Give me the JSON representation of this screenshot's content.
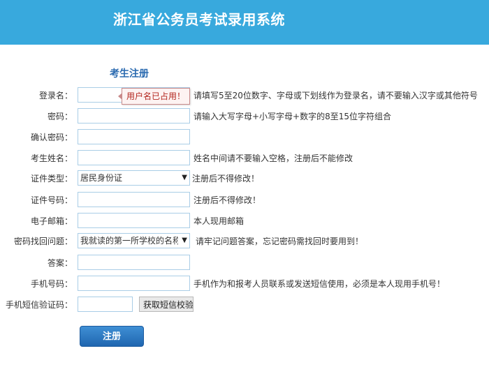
{
  "header": {
    "title": "浙江省公务员考试录用系统"
  },
  "form": {
    "section_title": "考生注册",
    "username": {
      "label": "登录名：",
      "value": "",
      "hint": "请填写5至20位数字、字母或下划线作为登录名，请不要输入汉字或其他符号",
      "error_tip": "用户名已占用！"
    },
    "password": {
      "label": "密码：",
      "value": "",
      "hint": "请输入大写字母+小写字母+数字的8至15位字符组合"
    },
    "confirm_password": {
      "label": "确认密码：",
      "value": ""
    },
    "real_name": {
      "label": "考生姓名：",
      "value": "",
      "hint": "姓名中间请不要输入空格，注册后不能修改"
    },
    "id_type": {
      "label": "证件类型：",
      "value": "居民身份证",
      "hint": "注册后不得修改！"
    },
    "id_number": {
      "label": "证件号码：",
      "value": "",
      "hint": "注册后不得修改！"
    },
    "email": {
      "label": "电子邮箱：",
      "value": "",
      "hint": "本人现用邮箱"
    },
    "security_question": {
      "label": "密码找回问题：",
      "value": "我就读的第一所学校的名称",
      "hint": "请牢记问题答案，忘记密码需找回时要用到！"
    },
    "answer": {
      "label": "答案：",
      "value": ""
    },
    "phone": {
      "label": "手机号码：",
      "value": "",
      "hint": "手机作为和报考人员联系或发送短信使用，必须是本人现用手机号！"
    },
    "sms_code": {
      "label": "手机短信验证码：",
      "value": "",
      "button": "获取短信校验码"
    },
    "submit_label": "注册"
  }
}
